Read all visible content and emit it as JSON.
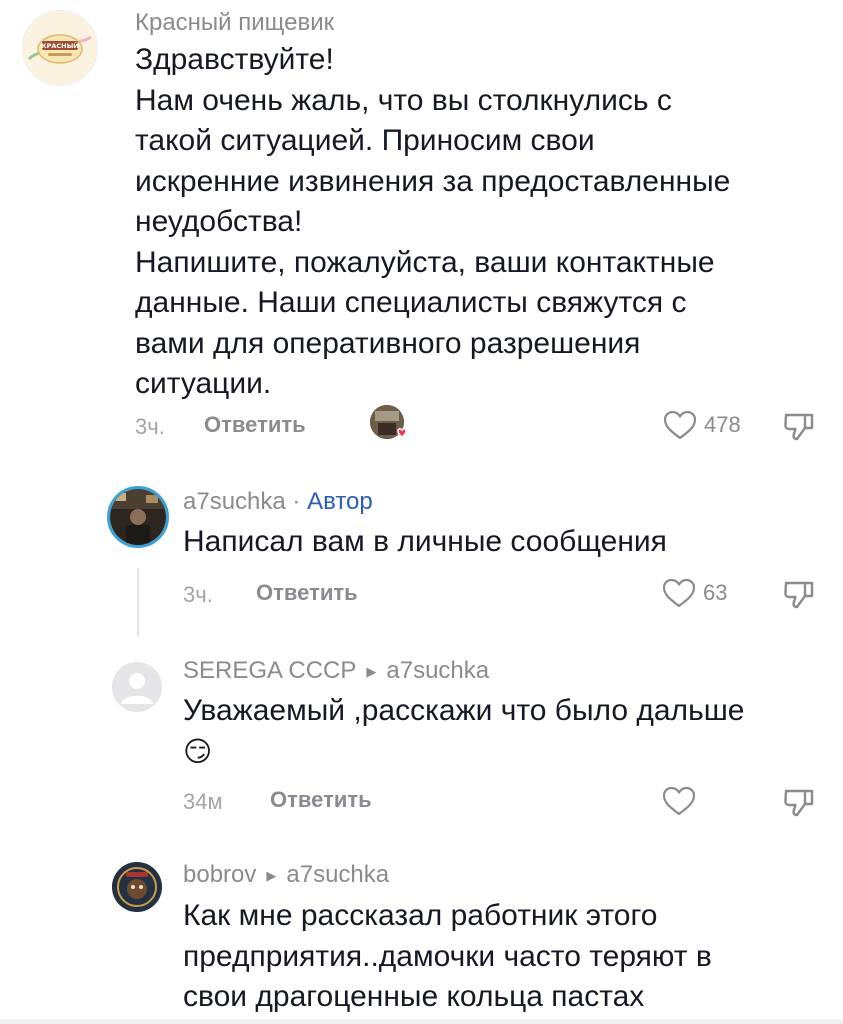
{
  "comments": [
    {
      "author": "Красный пищевик",
      "avatar_label": "КРАСНЫЙ",
      "lines": [
        "Здравствуйте!",
        "Нам очень жаль, что вы столкнулись с",
        "такой ситуацией. Приносим свои",
        "искренние извинения за предоставленные",
        "неудобства!",
        "Напишите, пожалуйста, ваши контактные",
        "данные. Наши специалисты свяжутся с",
        "вами для оперативного разрешения",
        "ситуации."
      ],
      "time": "3ч.",
      "reply_label": "Ответить",
      "likes": "478"
    },
    {
      "author": "a7suchka",
      "separator": "·",
      "badge": "Автор",
      "lines": [
        "Написал вам в личные сообщения"
      ],
      "time": "3ч.",
      "reply_label": "Ответить",
      "likes": "63"
    },
    {
      "author": "SEREGA CCCP",
      "reply_to": "a7suchka",
      "lines": [
        "Уважаемый ,расскажи что было дальше",
        "😏"
      ],
      "time": "34м",
      "reply_label": "Ответить",
      "likes": ""
    },
    {
      "author": "bobrov",
      "reply_to": "a7suchka",
      "lines": [
        "Как мне рассказал работник этого",
        "предприятия..дамочки часто теряют в",
        "свои драгоценные кольца пастах"
      ]
    }
  ],
  "icons": {
    "reply_arrow": "▶",
    "like": "heart-outline-icon",
    "dislike": "thumbs-down-icon"
  },
  "colors": {
    "author_badge": "#2b5db9",
    "secondary_text": "#8a8b91",
    "liked_heart": "#fe2c55"
  }
}
